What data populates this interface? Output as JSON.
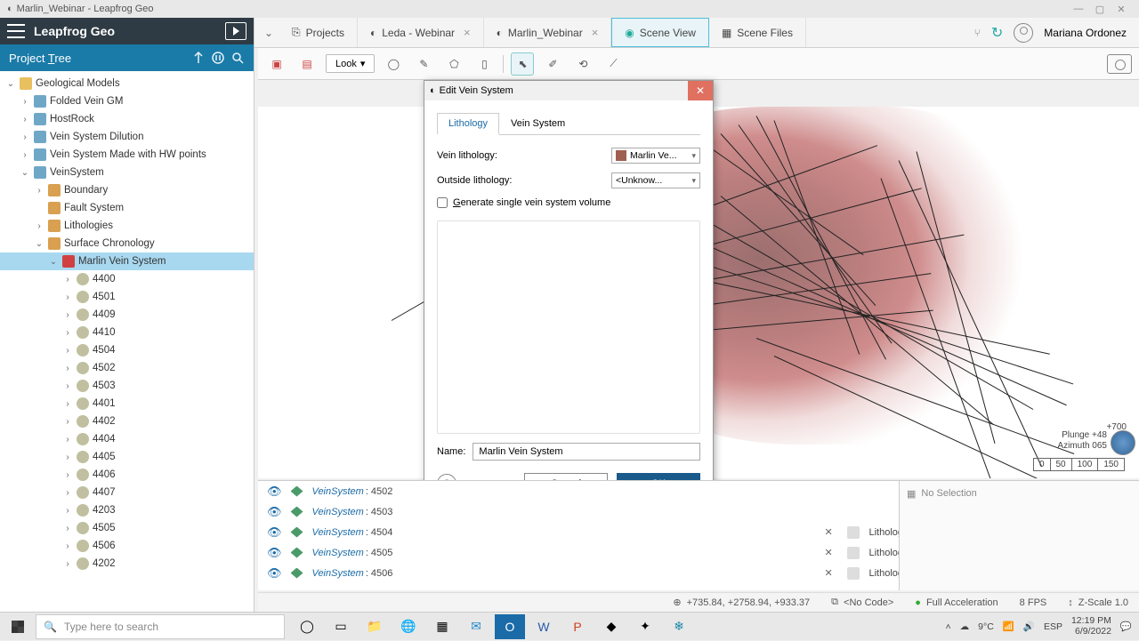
{
  "titlebar": {
    "text": "Marlin_Webinar - Leapfrog Geo"
  },
  "app": {
    "name": "Leapfrog Geo"
  },
  "tabs": {
    "projects": "Projects",
    "leda": "Leda - Webinar",
    "marlin": "Marlin_Webinar",
    "scene_view": "Scene View",
    "scene_files": "Scene Files"
  },
  "user": {
    "name": "Mariana Ordonez"
  },
  "toolbar": {
    "look": "Look"
  },
  "project_tree": {
    "title": "Project Tree",
    "root": "Geological Models",
    "items": [
      "Folded Vein GM",
      "HostRock",
      "Vein System Dilution",
      "Vein System Made with HW points",
      "VeinSystem"
    ],
    "vein_children": [
      "Boundary",
      "Fault System",
      "Lithologies",
      "Surface Chronology"
    ],
    "marlin": "Marlin Vein System",
    "numbers": [
      "4400",
      "4501",
      "4409",
      "4410",
      "4504",
      "4502",
      "4503",
      "4401",
      "4402",
      "4404",
      "4405",
      "4406",
      "4407",
      "4203",
      "4505",
      "4506",
      "4202"
    ]
  },
  "dialog": {
    "title": "Edit Vein System",
    "tab_lithology": "Lithology",
    "tab_veinsystem": "Vein System",
    "field_vein": "Vein lithology:",
    "vein_value": "Marlin Ve...",
    "field_outside": "Outside lithology:",
    "outside_value": "<Unknow...",
    "checkbox": "Generate single vein system volume",
    "name_label": "Name:",
    "name_value": "Marlin Vein System",
    "cancel": "Cancel",
    "ok": "OK"
  },
  "scene_items": [
    {
      "label": "VeinSystem",
      "id": "4502",
      "lith": "",
      "color": ""
    },
    {
      "label": "VeinSystem",
      "id": "4503",
      "lith": "",
      "color": ""
    },
    {
      "label": "VeinSystem",
      "id": "4504",
      "lith": "Lithology",
      "color": "#5bb8e8"
    },
    {
      "label": "VeinSystem",
      "id": "4505",
      "lith": "Lithology",
      "color": "#2040d8"
    },
    {
      "label": "VeinSystem",
      "id": "4506",
      "lith": "Lithology",
      "color": "#40d890"
    }
  ],
  "viewport": {
    "plunge": "Plunge  +48",
    "azimuth": "Azimuth  065",
    "plus700": "+700",
    "scale": [
      "0",
      "50",
      "100",
      "150"
    ]
  },
  "no_selection": "No Selection",
  "status": {
    "coords": "+735.84, +2758.94, +933.37",
    "code": "<No Code>",
    "accel": "Full Acceleration",
    "fps": "8 FPS",
    "zscale": "Z-Scale 1.0"
  },
  "taskbar": {
    "search_placeholder": "Type here to search",
    "weather": "9°C",
    "lang": "ESP",
    "time": "12:19 PM",
    "date": "6/9/2022"
  }
}
